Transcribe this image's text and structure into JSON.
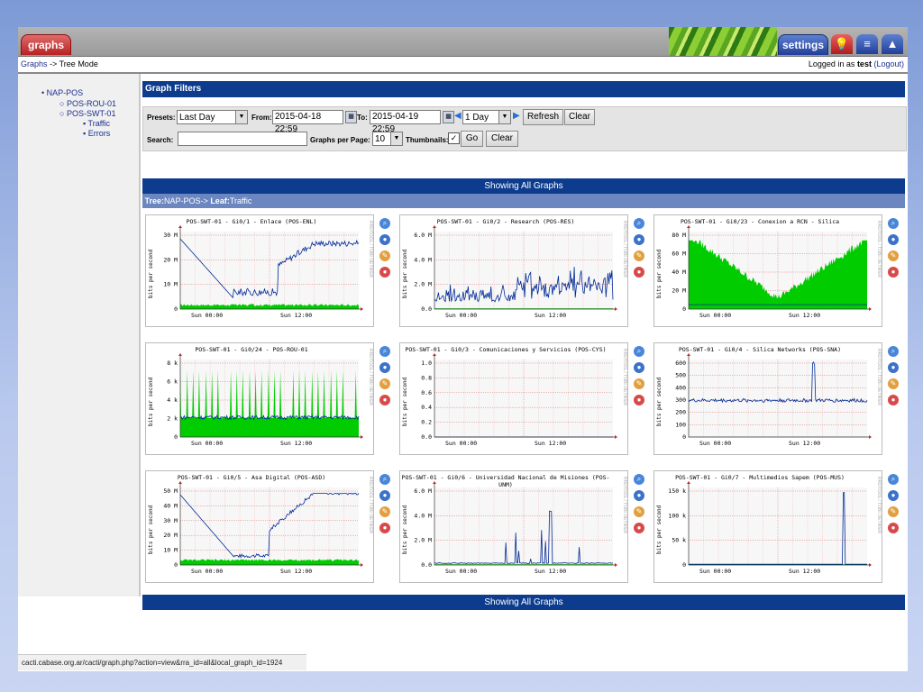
{
  "header": {
    "tab_graphs": "graphs",
    "tab_settings": "settings",
    "icons": [
      "bulb-icon",
      "list-icon",
      "mountain-icon"
    ]
  },
  "breadcrumb": {
    "root": "Graphs",
    "sep": "->",
    "current": "Tree Mode"
  },
  "login": {
    "prefix": "Logged in as",
    "user": "test",
    "logout": "(Logout)"
  },
  "tree": {
    "root": "NAP-POS",
    "children": [
      {
        "label": "POS-ROU-01"
      },
      {
        "label": "POS-SWT-01",
        "leaves": [
          "Traffic",
          "Errors"
        ]
      }
    ]
  },
  "filters": {
    "title": "Graph Filters",
    "presets_label": "Presets:",
    "presets_value": "Last Day",
    "from_label": "From:",
    "from_value": "2015-04-18 22:59",
    "to_label": "To:",
    "to_value": "2015-04-19 22:59",
    "span_value": "1 Day",
    "refresh": "Refresh",
    "clear": "Clear",
    "search_label": "Search:",
    "search_value": "",
    "per_page_label": "Graphs per Page:",
    "per_page_value": "10",
    "thumbs_label": "Thumbnails:",
    "thumbs_checked": "✓",
    "go": "Go",
    "clear2": "Clear"
  },
  "showing": "Showing All Graphs",
  "tree_leaf": {
    "tree_label": "Tree:",
    "tree_value": "NAP-POS->",
    "leaf_label": "Leaf:",
    "leaf_value": "Traffic"
  },
  "graphs": [
    {
      "title": "POS-SWT-01 - Gi0/1 - Enlace (POS-ENL)",
      "ylabel": "bits per second",
      "yticks": [
        "30 M",
        "20 M",
        "10 M",
        "0"
      ],
      "xticks": [
        "Sun 00:00",
        "Sun 12:00"
      ]
    },
    {
      "title": "POS-SWT-01 - Gi0/2 - Research (POS-RES)",
      "ylabel": "bits per second",
      "yticks": [
        "6.0 M",
        "4.0 M",
        "2.0 M",
        "0.0"
      ],
      "xticks": [
        "Sun 00:00",
        "Sun 12:00"
      ]
    },
    {
      "title": "POS-SWT-01 - Gi0/23 - Conexion a RCN - Silica",
      "ylabel": "bits per second",
      "yticks": [
        "80 M",
        "60 M",
        "40 M",
        "20 M",
        "0"
      ],
      "xticks": [
        "Sun 00:00",
        "Sun 12:00"
      ]
    },
    {
      "title": "POS-SWT-01 - Gi0/24 - POS-ROU-01",
      "ylabel": "bits per second",
      "yticks": [
        "8 k",
        "6 k",
        "4 k",
        "2 k",
        "0"
      ],
      "xticks": [
        "Sun 00:00",
        "Sun 12:00"
      ]
    },
    {
      "title": "POS-SWT-01 - Gi0/3 - Comunicaciones y Servicios (POS-CYS)",
      "ylabel": "bits per second",
      "yticks": [
        "1.0",
        "0.8",
        "0.6",
        "0.4",
        "0.2",
        "0.0"
      ],
      "xticks": [
        "Sun 00:00",
        "Sun 12:00"
      ]
    },
    {
      "title": "POS-SWT-01 - Gi0/4 - Silica Networks (POS-SNA)",
      "ylabel": "bits per second",
      "yticks": [
        "600",
        "500",
        "400",
        "300",
        "200",
        "100",
        "0"
      ],
      "xticks": [
        "Sun 00:00",
        "Sun 12:00"
      ]
    },
    {
      "title": "POS-SWT-01 - Gi0/5 - Asa Digital (POS-ASD)",
      "ylabel": "bits per second",
      "yticks": [
        "50 M",
        "40 M",
        "30 M",
        "20 M",
        "10 M",
        "0"
      ],
      "xticks": [
        "Sun 00:00",
        "Sun 12:00"
      ]
    },
    {
      "title": "POS-SWT-01 - Gi0/6 - Universidad Nacional de Misiones (POS-UNM)",
      "ylabel": "bits per second",
      "yticks": [
        "6.0 M",
        "4.0 M",
        "2.0 M",
        "0.0"
      ],
      "xticks": [
        "Sun 00:00",
        "Sun 12:00"
      ]
    },
    {
      "title": "POS-SWT-01 - Gi0/7 - Multimedios Sapem (POS-MUS)",
      "ylabel": "bits per second",
      "yticks": [
        "150 k",
        "100 k",
        "50 k",
        "0"
      ],
      "xticks": [
        "Sun 00:00",
        "Sun 12:00"
      ]
    }
  ],
  "rrdtool": "RRDTOOL / TOBI OETIKER",
  "status_url": "cacti.cabase.org.ar/cacti/graph.php?action=view&rra_id=all&local_graph_id=1924",
  "colors": {
    "accent": "#0d3b8e",
    "inbound": "#00cc00",
    "outbound": "#002a97"
  }
}
